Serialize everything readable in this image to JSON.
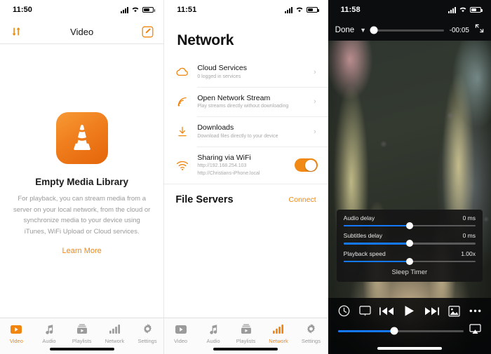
{
  "accent": "#f0860f",
  "blue": "#1479ff",
  "panel_video": {
    "status": {
      "time": "11:50",
      "icons": [
        "signal-bars",
        "wifi",
        "battery"
      ]
    },
    "navbar": {
      "sort_icon": "sort-arrows-icon",
      "title": "Video",
      "edit_icon": "edit-pencil-icon"
    },
    "empty_state": {
      "app_icon": "vlc-cone-icon",
      "title": "Empty Media Library",
      "description": "For playback, you can stream media from a server on your local network, from the cloud or synchronize media to your device using iTunes, WiFi Upload or Cloud services.",
      "link": "Learn More"
    },
    "tabs": [
      {
        "label": "Video",
        "icon": "video-icon",
        "active": true
      },
      {
        "label": "Audio",
        "icon": "music-note-icon",
        "active": false
      },
      {
        "label": "Playlists",
        "icon": "playlists-icon",
        "active": false
      },
      {
        "label": "Network",
        "icon": "network-bars-icon",
        "active": false
      },
      {
        "label": "Settings",
        "icon": "gear-icon",
        "active": false
      }
    ]
  },
  "panel_network": {
    "status": {
      "time": "11:51"
    },
    "title": "Network",
    "rows": [
      {
        "icon": "cloud-icon",
        "title": "Cloud Services",
        "subtitle": "0 logged in services",
        "accessory": "chevron"
      },
      {
        "icon": "stream-icon",
        "title": "Open Network Stream",
        "subtitle": "Play streams directly without downloading",
        "accessory": "chevron"
      },
      {
        "icon": "download-icon",
        "title": "Downloads",
        "subtitle": "Download files directly to your device",
        "accessory": "chevron"
      },
      {
        "icon": "wifi-icon",
        "title": "Sharing via WiFi",
        "subtitle": "http://192.168.254.103",
        "subtitle2": "http://Christians-iPhone.local",
        "accessory": "toggle",
        "toggle_on": true
      }
    ],
    "section": {
      "title": "File Servers",
      "action": "Connect"
    },
    "tabs": [
      {
        "label": "Video",
        "icon": "video-icon",
        "active": false
      },
      {
        "label": "Audio",
        "icon": "music-note-icon",
        "active": false
      },
      {
        "label": "Playlists",
        "icon": "playlists-icon",
        "active": false
      },
      {
        "label": "Network",
        "icon": "network-bars-icon",
        "active": true
      },
      {
        "label": "Settings",
        "icon": "gear-icon",
        "active": false
      }
    ]
  },
  "panel_player": {
    "status": {
      "time": "11:58"
    },
    "topbar": {
      "done_label": "Done",
      "chevron_icon": "chevron-down-icon",
      "remaining_time": "-00:05",
      "expand_icon": "expand-icon",
      "scrub_percent": 3
    },
    "options": [
      {
        "label": "Audio delay",
        "value": "0 ms",
        "percent": 50
      },
      {
        "label": "Subtitles delay",
        "value": "0 ms",
        "percent": 50
      },
      {
        "label": "Playback speed",
        "value": "1.00x",
        "percent": 50
      }
    ],
    "sleep_timer": "Sleep Timer",
    "controls": [
      "clock-icon",
      "subtitles-screen-icon",
      "previous-icon",
      "play-icon",
      "next-icon",
      "aspect-ratio-icon",
      "more-options-icon"
    ],
    "volume": {
      "percent": 45,
      "airplay_icon": "airplay-icon"
    }
  }
}
